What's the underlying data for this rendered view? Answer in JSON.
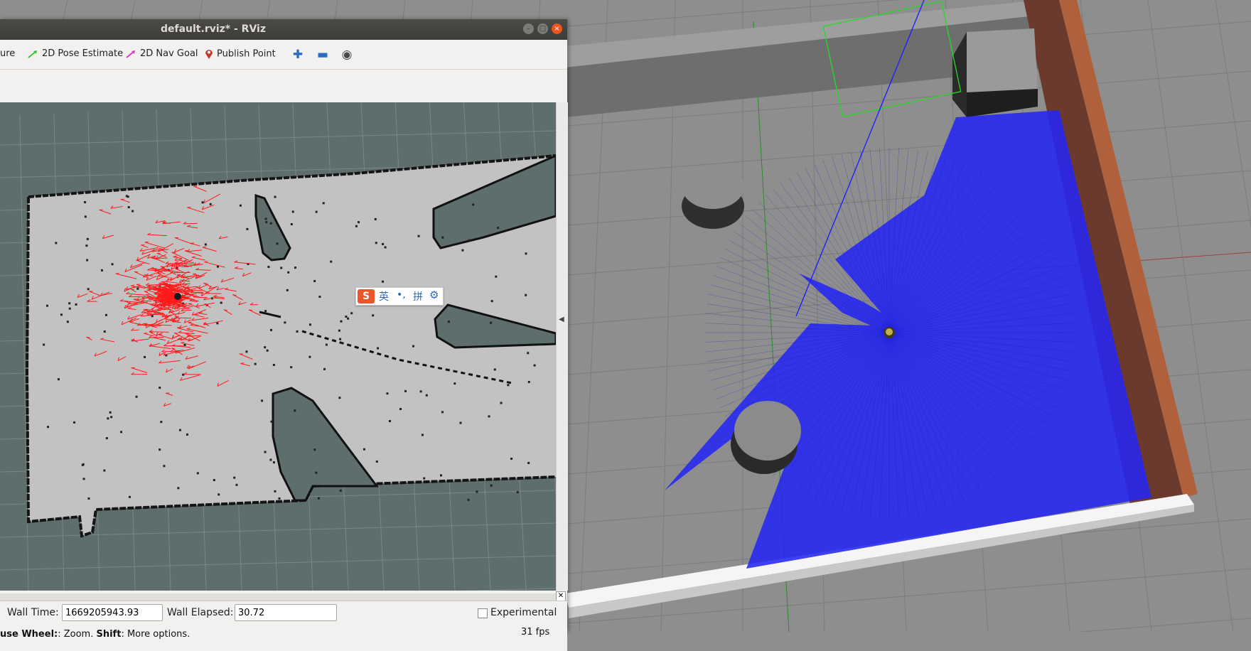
{
  "window": {
    "title": "default.rviz* - RViz",
    "controls": {
      "minimize": "–",
      "maximize": "□",
      "close": "×"
    }
  },
  "toolbar": {
    "items": [
      {
        "label": "ure",
        "icon": "truncated-tool-icon"
      },
      {
        "label": "2D Pose Estimate",
        "icon": "green-arrow-icon",
        "color": "#3cc23c"
      },
      {
        "label": "2D Nav Goal",
        "icon": "magenta-arrow-icon",
        "color": "#d43cc8"
      },
      {
        "label": "Publish Point",
        "icon": "map-pin-icon",
        "color": "#c0392b"
      }
    ],
    "extra_icons": [
      "plus-icon",
      "minus-icon",
      "eye-icon"
    ]
  },
  "ime": {
    "logo": "S",
    "lang": "英",
    "punct": "•,",
    "mode": "拼",
    "settings_icon": "gear-icon"
  },
  "timebar": {
    "wall_time_label": "Wall Time:",
    "wall_time_value": "1669205943.93",
    "wall_elapsed_label": "Wall Elapsed:",
    "wall_elapsed_value": "30.72",
    "experimental_label": "Experimental"
  },
  "status": {
    "hint_bold1": "use Wheel:",
    "hint_mid": ": Zoom. ",
    "hint_bold2": "Shift",
    "hint_end": ": More options.",
    "fps": "31 fps"
  },
  "colors": {
    "laser": "#1b1bff",
    "particles": "#ff1a1a",
    "map_free": "#c2c2c2",
    "map_unknown": "#5d6e6d",
    "ubuntu_orange": "#e95420"
  }
}
